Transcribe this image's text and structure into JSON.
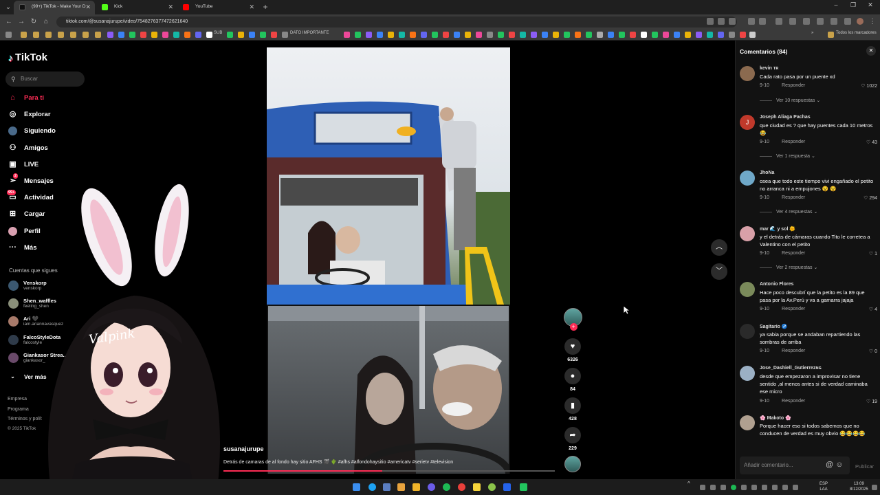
{
  "browser": {
    "tabs": [
      {
        "title": "(99+) TikTok - Make Your D",
        "active": true
      },
      {
        "title": "Kick",
        "active": false
      },
      {
        "title": "YouTube",
        "active": false
      }
    ],
    "url": "tiktok.com/@susanajurupe/video/7548276377472621640",
    "bookmarks": {
      "sub": "SUB",
      "dato": "DATO IMPORTANTE",
      "all": "Todos los marcadores"
    }
  },
  "sidebar": {
    "logo": "TikTok",
    "search_placeholder": "Buscar",
    "nav": [
      {
        "label": "Para ti",
        "icon": "home-icon"
      },
      {
        "label": "Explorar",
        "icon": "compass-icon"
      },
      {
        "label": "Siguiendo",
        "icon": "following-icon"
      },
      {
        "label": "Amigos",
        "icon": "friends-icon"
      },
      {
        "label": "LIVE",
        "icon": "live-icon"
      },
      {
        "label": "Mensajes",
        "icon": "messages-icon",
        "badge": "2"
      },
      {
        "label": "Actividad",
        "icon": "activity-icon",
        "badge": "99+"
      },
      {
        "label": "Cargar",
        "icon": "upload-icon"
      },
      {
        "label": "Perfil",
        "icon": "profile-icon"
      },
      {
        "label": "Más",
        "icon": "more-icon"
      }
    ],
    "following_title": "Cuentas que sigues",
    "following": [
      {
        "name": "Venskorp",
        "handle": "venskorp"
      },
      {
        "name": "Shen_waffles",
        "handle": "feeling_shen"
      },
      {
        "name": "Ari 🖤",
        "handle": "iam.ariannavasquez"
      },
      {
        "name": "FalcoStyleDota",
        "handle": "falcostyle"
      },
      {
        "name": "Giankasor Strea...",
        "handle": "giankasor_"
      }
    ],
    "see_more": "Ver más",
    "footer": [
      "Empresa",
      "Programa",
      "Términos y polít",
      "© 2025 TikTok"
    ]
  },
  "vtuber": {
    "sign": "Valpink"
  },
  "video": {
    "username": "susanajurupe",
    "description": "Detrás de camaras de al fondo hay sitio AFHS 🎬 🌵 #afhs #alfondohaysitio #americatv #serietv #television",
    "progress": 0.48
  },
  "actions": {
    "likes": "6326",
    "comments": "84",
    "saves": "428",
    "shares": "229"
  },
  "comments_panel": {
    "title": "Comentarios (84)",
    "reply_label": "Responder",
    "items": [
      {
        "user": "kevin ᴛʀ",
        "text": "Cada rato pasa por un puente xd",
        "date": "9-10",
        "likes": "1022",
        "more": "Ver 10 respuestas",
        "color": "#8b6a4f"
      },
      {
        "user": "Joseph Aliaga Pachas",
        "text": "que ciudad es ? que hay puentes cada 10 metros😂",
        "date": "9-10",
        "likes": "43",
        "more": "Ver 1 respuesta",
        "color": "#c0392b"
      },
      {
        "user": "JhoNa",
        "text": "osea que todo este tiempo vivi engañado el petito no arranca ni a empujones 😵 😵",
        "date": "9-10",
        "likes": "294",
        "more": "Ver 4 respuestas",
        "color": "#6fa8c8"
      },
      {
        "user": "mar 🌊 y sol 🌞",
        "text": "y el detrás de cámaras cuando Tito le correteа a Valentino con el petito",
        "date": "9-10",
        "likes": "1",
        "more": "Ver 2 respuestas",
        "color": "#d8a0a8"
      },
      {
        "user": "Antonio Flores",
        "text": "Hace poco descubrí que la petito es la 89 que pasa por la Av.Perú y va a gamarra jajaja",
        "date": "9-10",
        "likes": "4",
        "color": "#7a8a5a"
      },
      {
        "user": "Sagitario ♐",
        "text": "ya sabia porque se andaban repartiendo las sombras de arriba",
        "date": "9-10",
        "likes": "0",
        "color": "#2a2a2a"
      },
      {
        "user": "Jose_Dashiell_Gutierrezɴɢ",
        "text": "desde que empezaron a improvisar no tiene sentido ,al menos antes si de verdad caminaba ese micro",
        "date": "9-10",
        "likes": "19",
        "color": "#9bb0c4"
      },
      {
        "user": "🌸 Makoto 🌸",
        "text": "Porque hacer eso si todos sabemos que no conducen de verdad es muy obvio 😂😂😂😂",
        "date": "9-10",
        "likes": "",
        "color": "#b0a090"
      }
    ],
    "input_placeholder": "Añadir comentario...",
    "publish": "Publicar"
  },
  "taskbar": {
    "lang": "ESP",
    "lang2": "LAA",
    "time": "13:09",
    "date": "8/12/2025"
  }
}
